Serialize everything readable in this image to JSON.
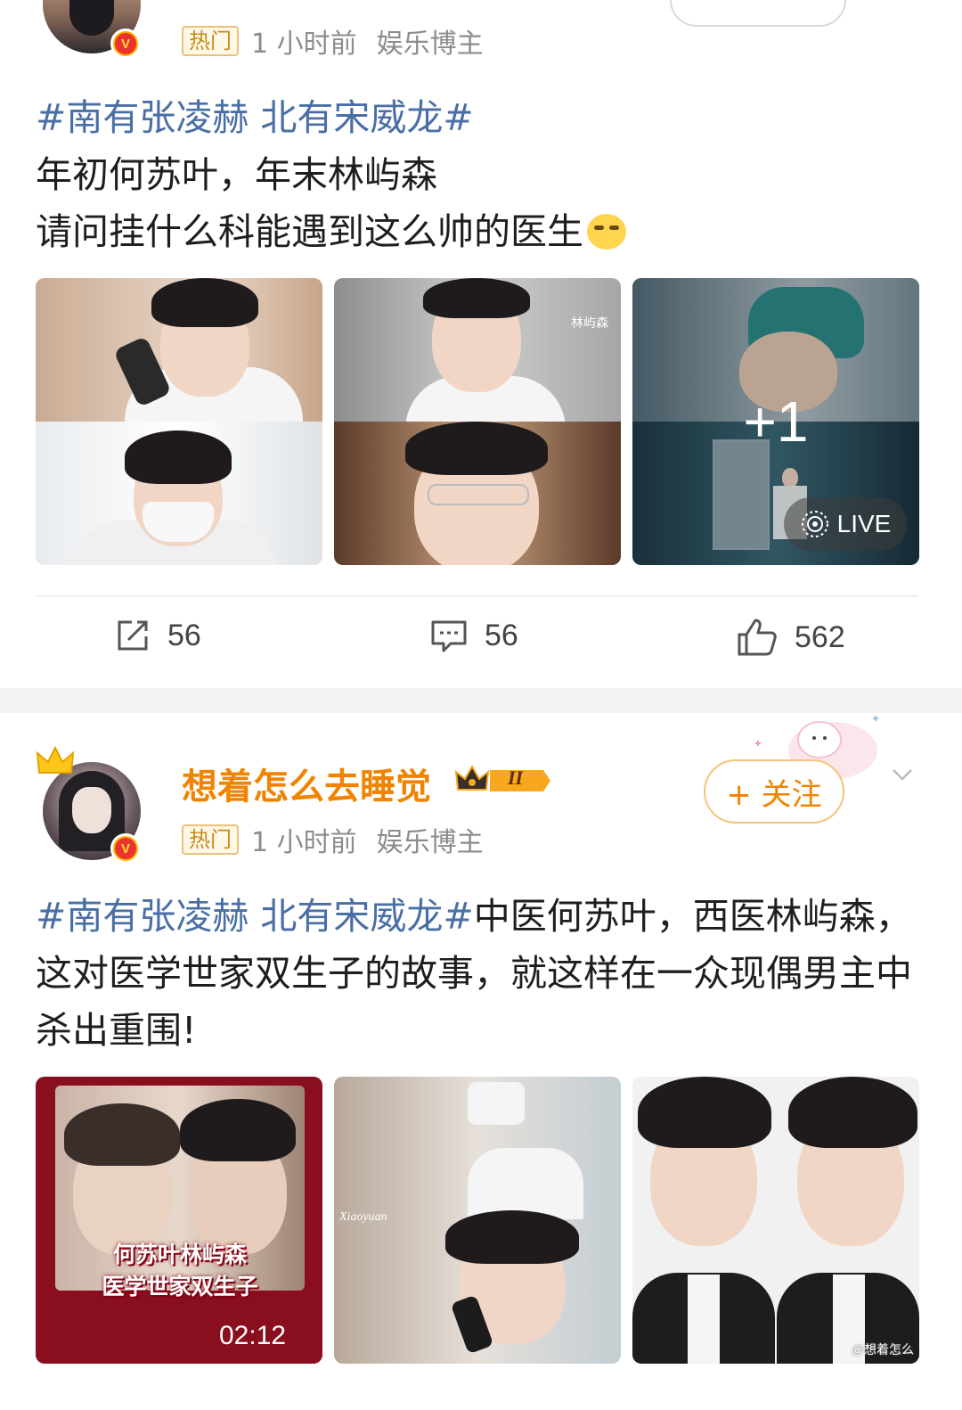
{
  "post1": {
    "hot_label": "热门",
    "time": "1 小时前",
    "category": "娱乐博主",
    "text_topic": "#南有张凌赫 北有宋威龙#",
    "text_line2": "年初何苏叶，年末林屿森",
    "text_line3": "请问挂什么科能遇到这么帅的医生",
    "images": [
      {
        "overlay": ""
      },
      {
        "overlay": "林屿森"
      },
      {
        "overlay": "+1",
        "badge": "LIVE"
      }
    ],
    "actions": {
      "repost": "56",
      "comment": "56",
      "like": "562"
    }
  },
  "post2": {
    "username": "想着怎么去睡觉",
    "level": "II",
    "follow_label": "+ 关注",
    "hot_label": "热门",
    "time": "1 小时前",
    "category": "娱乐博主",
    "text_topic": "#南有张凌赫 北有宋威龙#",
    "text_body": "中医何苏叶，西医林屿森，这对医学世家双生子的故事，就这样在一众现偶男主中杀出重围!",
    "images": [
      {
        "caption1": "何苏叶林屿森",
        "caption2": "医学世家双生子",
        "duration": "02:12"
      },
      {
        "overlay": "Xiaoyuan"
      },
      {
        "watermark": "@想着怎么"
      }
    ]
  },
  "colors": {
    "topic": "#4a6fa5",
    "username": "#f08300",
    "hot_tag_border": "#e9c27a",
    "separator": "#f2f2f2"
  }
}
